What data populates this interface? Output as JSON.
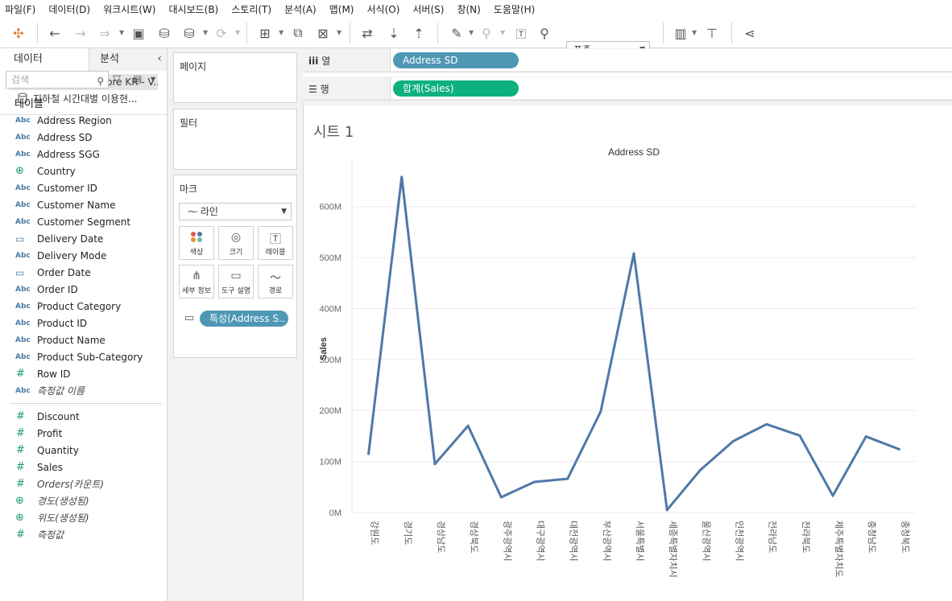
{
  "menu": [
    "파일(F)",
    "데이터(D)",
    "워크시트(W)",
    "대시보드(B)",
    "스토리(T)",
    "분석(A)",
    "맵(M)",
    "서식(O)",
    "서버(S)",
    "창(N)",
    "도움말(H)"
  ],
  "toolbar": {
    "fit": "표준"
  },
  "datapane": {
    "tab_data": "데이터",
    "tab_analysis": "분석",
    "datasources": [
      "Orders(Superstore KR - V...",
      "지하철 시간대별 이용현..."
    ],
    "search_placeholder": "검색",
    "tables_label": "테이블",
    "dimensions": [
      {
        "type": "Abc",
        "name": "Address Region"
      },
      {
        "type": "Abc",
        "name": "Address SD"
      },
      {
        "type": "Abc",
        "name": "Address SGG"
      },
      {
        "type": "globe",
        "name": "Country"
      },
      {
        "type": "Abc",
        "name": "Customer ID"
      },
      {
        "type": "Abc",
        "name": "Customer Name"
      },
      {
        "type": "Abc",
        "name": "Customer Segment"
      },
      {
        "type": "calendar",
        "name": "Delivery Date"
      },
      {
        "type": "Abc",
        "name": "Delivery Mode"
      },
      {
        "type": "calendar",
        "name": "Order Date"
      },
      {
        "type": "Abc",
        "name": "Order ID"
      },
      {
        "type": "Abc",
        "name": "Product Category"
      },
      {
        "type": "Abc",
        "name": "Product ID"
      },
      {
        "type": "Abc",
        "name": "Product Name"
      },
      {
        "type": "Abc",
        "name": "Product Sub-Category"
      },
      {
        "type": "#",
        "name": "Row ID"
      },
      {
        "type": "Abc",
        "name": "측정값 이름"
      }
    ],
    "measures": [
      {
        "type": "#",
        "name": "Discount"
      },
      {
        "type": "#",
        "name": "Profit"
      },
      {
        "type": "#",
        "name": "Quantity"
      },
      {
        "type": "#",
        "name": "Sales"
      },
      {
        "type": "#",
        "name": "Orders(카운트)"
      },
      {
        "type": "globe",
        "name": "경도(생성됨)"
      },
      {
        "type": "globe",
        "name": "위도(생성됨)"
      },
      {
        "type": "#",
        "name": "측정값"
      }
    ]
  },
  "cards": {
    "pages": "페이지",
    "filters": "필터",
    "marks": "마크",
    "mark_type": "라인",
    "buttons": [
      "색상",
      "크기",
      "레이블",
      "세부 정보",
      "도구 설명",
      "경로"
    ],
    "tooltip_pill": "특성(Address S.."
  },
  "shelves": {
    "columns_label": "열",
    "rows_label": "행",
    "columns_pill": "Address SD",
    "rows_pill": "합계(Sales)"
  },
  "sheet": {
    "title": "시트 1"
  },
  "chart_data": {
    "type": "line",
    "title": "Address SD",
    "xlabel": "",
    "ylabel": "Sales",
    "categories": [
      "강원도",
      "경기도",
      "경상남도",
      "경상북도",
      "광주광역시",
      "대구광역시",
      "대전광역시",
      "부산광역시",
      "서울특별시",
      "세종특별자치시",
      "울산광역시",
      "인천광역시",
      "전라남도",
      "전라북도",
      "제주특별자치도",
      "충청남도",
      "충청북도"
    ],
    "series": [
      {
        "values": [
          115,
          658,
          95,
          170,
          30,
          60,
          66,
          198,
          508,
          5,
          83,
          140,
          173,
          151,
          33,
          149,
          124
        ]
      }
    ],
    "yticks": [
      "0M",
      "100M",
      "200M",
      "300M",
      "400M",
      "500M",
      "600M"
    ],
    "ylim": [
      0,
      680
    ],
    "grid": true,
    "color": "#4e79a7"
  }
}
